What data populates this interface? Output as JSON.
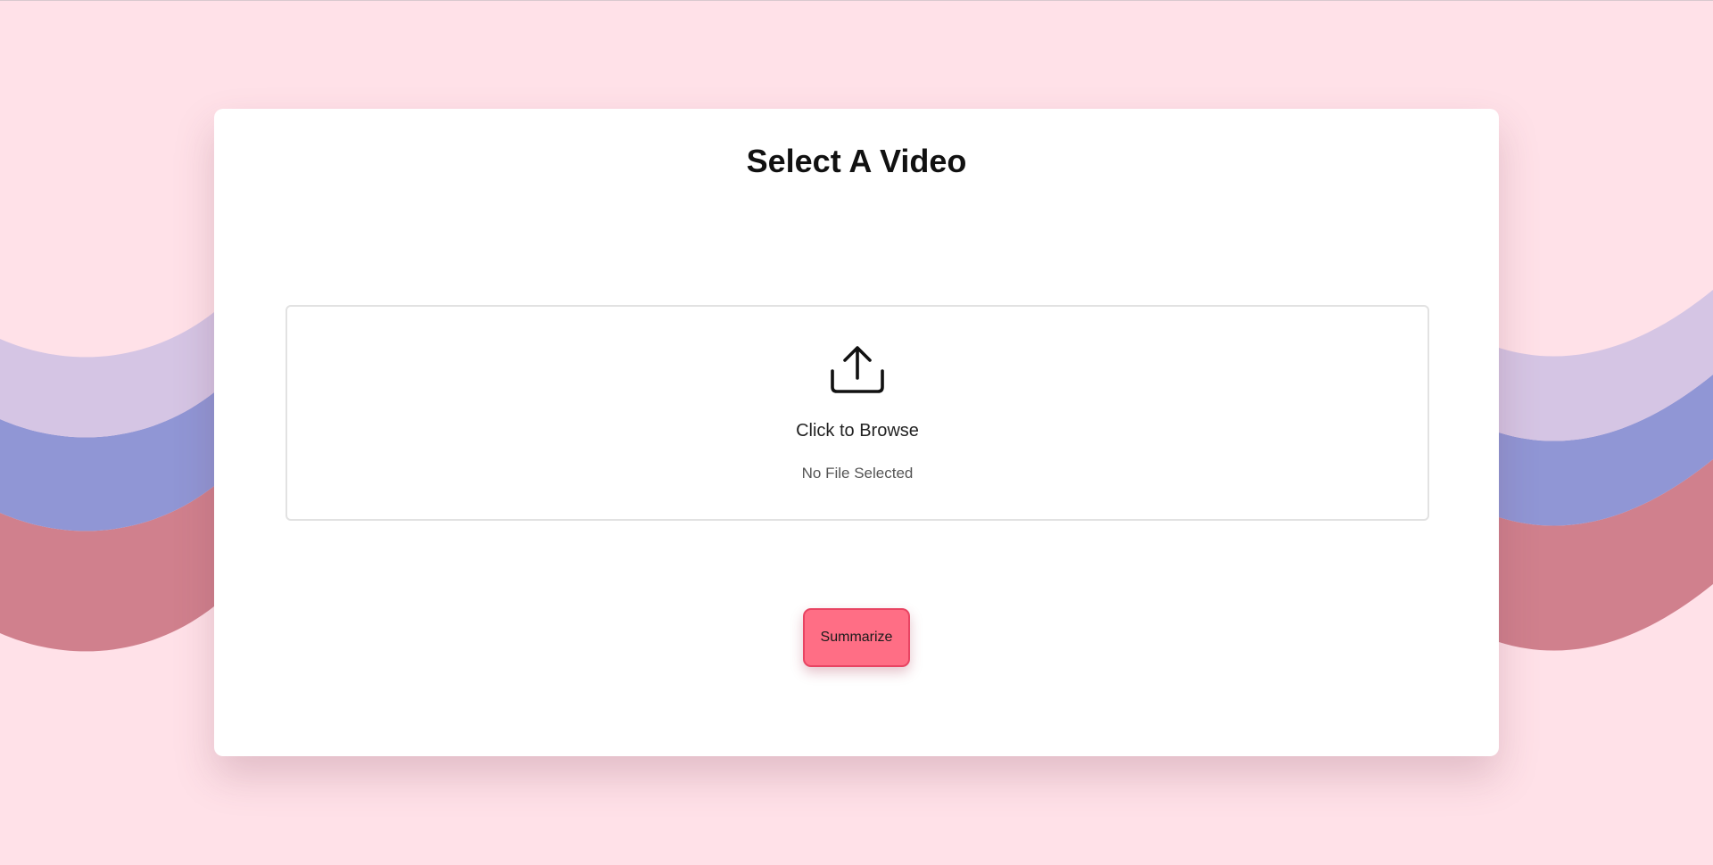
{
  "page": {
    "title": "Select A Video"
  },
  "upload": {
    "icon": "upload-icon",
    "browse_label": "Click to Browse",
    "file_status": "No File Selected"
  },
  "actions": {
    "summarize_label": "Summarize"
  },
  "colors": {
    "background": "#ffe1e8",
    "wave_lavender": "#d5c5e4",
    "wave_periwinkle": "#9096d5",
    "wave_rose": "#d0808d",
    "button_fill": "#ff6e85",
    "button_border": "#e84462"
  }
}
